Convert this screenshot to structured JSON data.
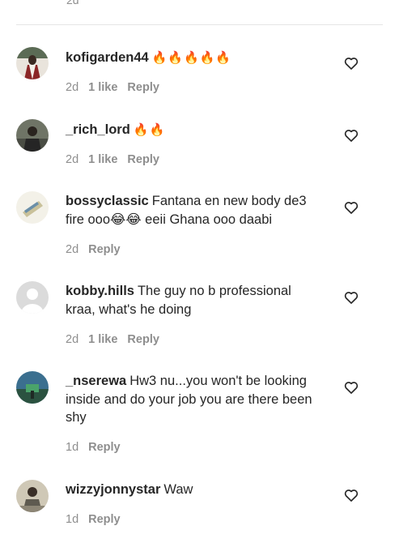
{
  "top": {
    "time": "2d"
  },
  "comments": [
    {
      "username": "kofigarden44",
      "text": "🔥🔥🔥🔥🔥",
      "time": "2d",
      "likes": "1 like",
      "reply": "Reply",
      "avatar_color": "#7a2a2a"
    },
    {
      "username": "_rich_lord",
      "text": "🔥🔥",
      "time": "2d",
      "likes": "1 like",
      "reply": "Reply",
      "avatar_color": "#3b3d36"
    },
    {
      "username": "bossyclassic",
      "text": "Fantana en new body de3 fire ooo😂😂 eeii Ghana ooo daabi",
      "time": "2d",
      "likes": "",
      "reply": "Reply",
      "avatar_color": "#d9d4b8"
    },
    {
      "username": "kobby.hills",
      "text": "The guy no b professional kraa, what's he doing",
      "time": "2d",
      "likes": "1 like",
      "reply": "Reply",
      "avatar_color": "#dcdcdc"
    },
    {
      "username": "_nserewa",
      "text": "Hw3 nu...you won't be looking inside and do your job you are there been shy",
      "time": "1d",
      "likes": "",
      "reply": "Reply",
      "avatar_color": "#2e5c4e"
    },
    {
      "username": "wizzyjonnystar",
      "text": "Waw",
      "time": "1d",
      "likes": "",
      "reply": "Reply",
      "avatar_color": "#8a8478"
    }
  ],
  "colors": {
    "text": "#262626",
    "meta": "#8e8e8e",
    "divider": "#e6e6e6"
  },
  "icons": {
    "like": "heart-outline-icon"
  }
}
